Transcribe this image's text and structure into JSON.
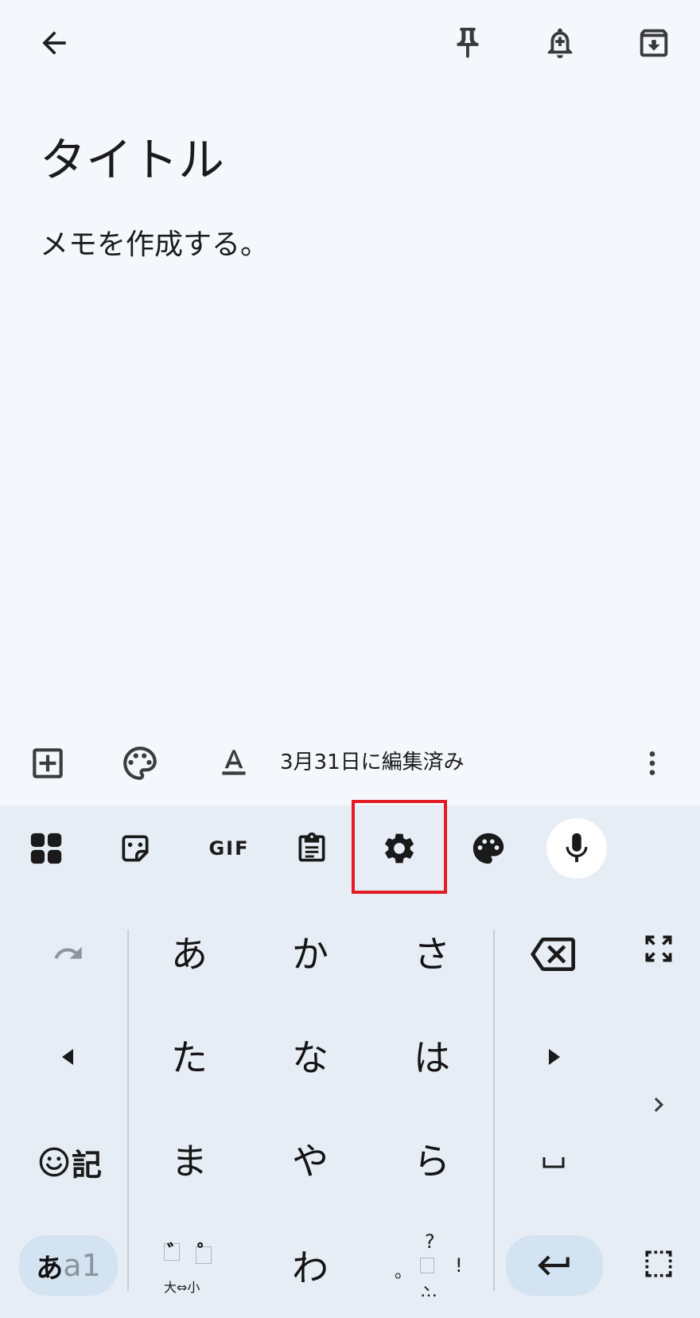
{
  "topbar": {
    "back_icon": "arrow-back-icon",
    "pin_icon": "pin-icon",
    "reminder_icon": "bell-plus-icon",
    "archive_icon": "archive-icon"
  },
  "note": {
    "title": "タイトル",
    "body": "メモを作成する。"
  },
  "editor_bar": {
    "add_icon": "add-box-icon",
    "palette_icon": "palette-icon",
    "text_format_icon": "text-format-icon",
    "edited_text": "3月31日に編集済み",
    "more_icon": "more-vert-icon"
  },
  "keyboard_toolbar": {
    "apps_icon": "apps-grid-icon",
    "sticker_icon": "sticker-icon",
    "gif_label": "GIF",
    "clipboard_icon": "clipboard-icon",
    "settings_icon": "gear-icon",
    "theme_icon": "palette-icon",
    "mic_icon": "microphone-icon"
  },
  "keyboard": {
    "undo_icon": "undo-icon",
    "left_icon": "left-triangle-icon",
    "emoji_symbol_label": "記",
    "mode_label_main": "あ",
    "mode_label_sub": "a1",
    "kana_rows": [
      [
        "あ",
        "か",
        "さ"
      ],
      [
        "た",
        "な",
        "は"
      ],
      [
        "ま",
        "や",
        "ら"
      ]
    ],
    "dakuten_top_1": "゛",
    "dakuten_top_2": "゜",
    "dakuten_bottom": "大⇔小",
    "wa": "わ",
    "punct_question": "?",
    "punct_comma": "、",
    "punct_exclaim": "!",
    "punct_period": "。",
    "punct_ellipsis": "…",
    "backspace_icon": "backspace-icon",
    "right_icon": "right-triangle-icon",
    "space_symbol": "␣",
    "enter_icon": "enter-icon",
    "fullscreen_icon": "expand-icon",
    "next_icon": "chevron-right-icon",
    "select_icon": "selection-box-icon"
  },
  "colors": {
    "background": "#f4f8fc",
    "keyboard_bg": "#e7edf4",
    "highlight": "#e31b23",
    "pill_blue": "#d3e3f1"
  }
}
